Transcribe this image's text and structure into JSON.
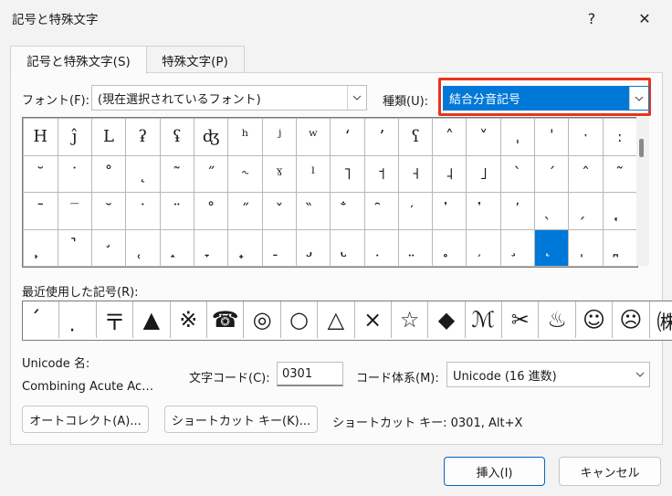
{
  "window": {
    "title": "記号と特殊文字",
    "help": "?",
    "close": "✕"
  },
  "tabs": [
    {
      "label": "記号と特殊文字(S)"
    },
    {
      "label": "特殊文字(P)"
    }
  ],
  "font": {
    "label": "フォント(F):",
    "value": "(現在選択されているフォント)"
  },
  "subset": {
    "label": "種類(U):",
    "value": "結合分音記号"
  },
  "grid_rows": [
    [
      "H",
      "ĵ",
      "L",
      "ʡ",
      "ʢ",
      "ʤ",
      "ʰ",
      "ʲ",
      "ʷ",
      "ʻ",
      "ʼ",
      "ʕ",
      "˄",
      "˅",
      "ˌ",
      "ˈ",
      "ˑ",
      "ː"
    ],
    [
      "˘",
      "˙",
      "˚",
      "˛",
      "˜",
      "˝",
      "˞",
      "ˠ",
      "ˡ",
      "˥",
      "˦",
      "˧",
      "˨",
      "˩",
      "`",
      "´",
      "ˆ",
      "˜"
    ],
    [
      "ˉ",
      "‾",
      "˘",
      "˙",
      "¨",
      "˚",
      "˝",
      "ˇ",
      "̏",
      "̐",
      "̑",
      "̒",
      "̓",
      "̔",
      "̕",
      "̖",
      "̗",
      "̘"
    ],
    [
      "̙",
      "̚",
      "̛",
      "̜",
      "̝",
      "̞",
      "̟",
      "̠",
      "̡",
      "̢",
      "̣",
      "̤",
      "̥",
      "̦",
      "̧",
      "̨",
      "̩",
      "̪"
    ]
  ],
  "selected_cell": "3,15",
  "recent": {
    "label": "最近使用した記号(R):",
    "symbols": [
      "́",
      "̣",
      "〒",
      "▲",
      "※",
      "☎",
      "◎",
      "○",
      "△",
      "×",
      "☆",
      "◆",
      "ℳ",
      "✂",
      "♨",
      "☺",
      "☹",
      "㈱"
    ]
  },
  "unicode_name": {
    "label": "Unicode 名:",
    "value": "Combining Acute Ac…"
  },
  "char_code": {
    "label": "文字コード(C):",
    "value": "0301"
  },
  "code_system": {
    "label": "コード体系(M):",
    "value": "Unicode (16 進数)"
  },
  "buttons": {
    "autocorrect": "オートコレクト(A)...",
    "shortcut": "ショートカット キー(K)...",
    "insert": "挿入(I)",
    "cancel": "キャンセル"
  },
  "shortcut_info": "ショートカット キー: 0301, Alt+X",
  "colors": {
    "selection": "#0078d7",
    "highlight": "#e8341c"
  }
}
